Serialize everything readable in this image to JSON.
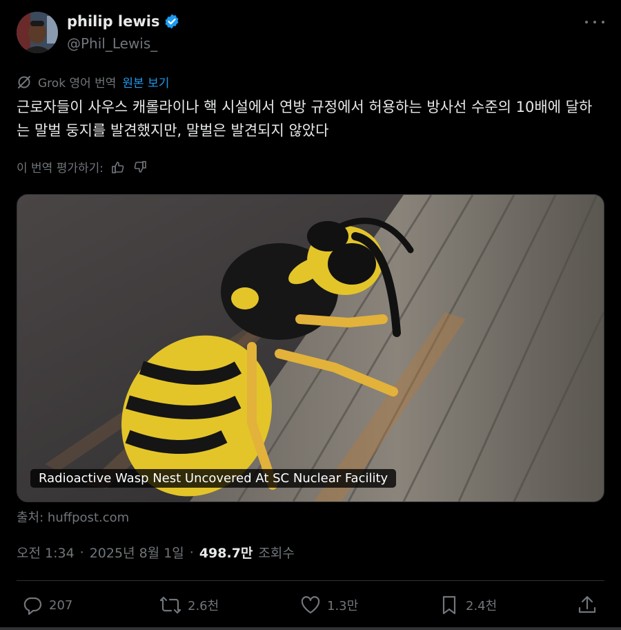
{
  "author": {
    "name": "philip lewis",
    "handle": "@Phil_Lewis_",
    "verified": true
  },
  "translation": {
    "label": "Grok 영어 번역",
    "show_original": "원본 보기"
  },
  "tweet": {
    "text": "근로자들이 사우스 캐롤라이나 핵 시설에서 연방 규정에서 허용하는 방사선 수준의 10배에 달하는 말벌 둥지를 발견했지만, 말벌은 발견되지 않았다"
  },
  "rate": {
    "label": "이 번역 평가하기:"
  },
  "media": {
    "caption": "Radioactive Wasp Nest Uncovered At SC Nuclear Facility"
  },
  "source": "출처: huffpost.com",
  "meta": {
    "time": "오전 1:34",
    "date": "2025년 8월 1일",
    "views": "498.7만",
    "views_label": "조회수"
  },
  "actions": {
    "replies": "207",
    "reposts": "2.6천",
    "likes": "1.3만",
    "bookmarks": "2.4천"
  },
  "colors": {
    "accent": "#1d9bf0",
    "muted": "#71767b",
    "text": "#e7e9ea",
    "background": "#000000"
  }
}
